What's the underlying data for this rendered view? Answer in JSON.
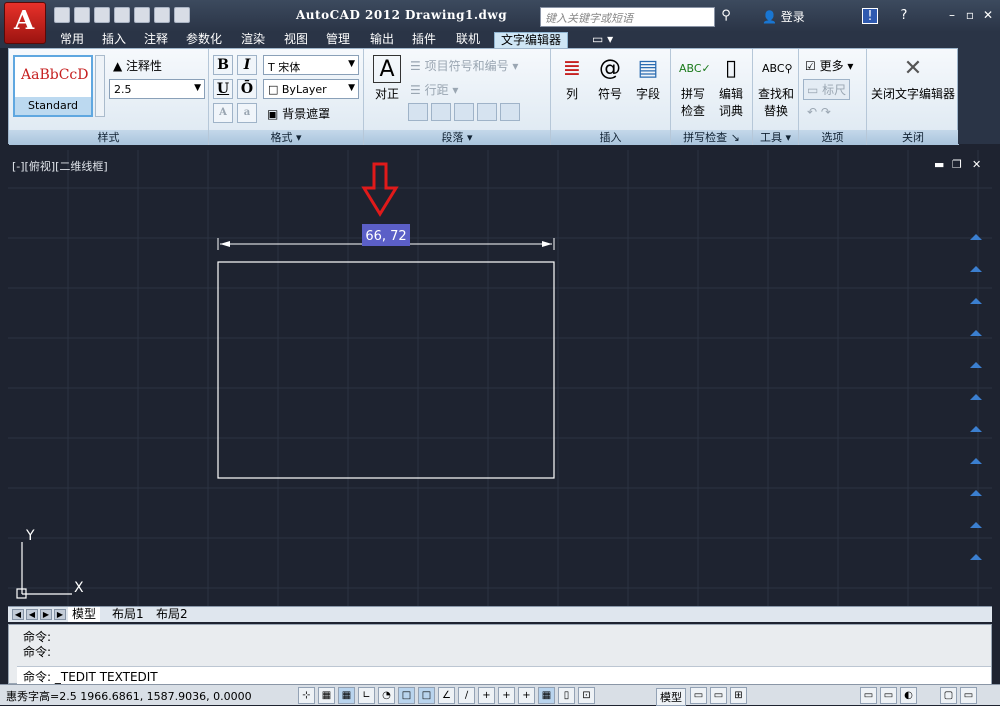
{
  "titlebar": {
    "app_title": "AutoCAD 2012",
    "doc_title": "Drawing1.dwg",
    "search_placeholder": "键入关键字或短语",
    "login_label": "登录"
  },
  "tabs": [
    {
      "label": "常用"
    },
    {
      "label": "插入"
    },
    {
      "label": "注释"
    },
    {
      "label": "参数化"
    },
    {
      "label": "渲染"
    },
    {
      "label": "视图"
    },
    {
      "label": "管理"
    },
    {
      "label": "输出"
    },
    {
      "label": "插件"
    },
    {
      "label": "联机"
    },
    {
      "label": "文字编辑器",
      "active": true
    }
  ],
  "ribbon": {
    "style_panel": {
      "label": "样式",
      "preview_sample": "AaBbCcD",
      "preview_name": "Standard",
      "annotative_label": "注释性",
      "height_value": "2.5"
    },
    "format_panel": {
      "label": "格式",
      "bold": "B",
      "italic": "I",
      "underline": "U",
      "overline": "Ō",
      "font_value": "宋体",
      "color_value": "ByLayer",
      "mask_label": "背景遮罩"
    },
    "paragraph_panel": {
      "label": "段落",
      "justify_label": "对正",
      "bullets_label": "项目符号和编号",
      "spacing_label": "行距"
    },
    "insert_panel": {
      "label": "插入",
      "columns_label": "列",
      "symbol_label": "符号",
      "field_label": "字段"
    },
    "spell_panel": {
      "label": "拼写检查",
      "spellcheck_label_1": "拼写",
      "spellcheck_label_2": "检查",
      "dictionary_label_1": "编辑",
      "dictionary_label_2": "词典"
    },
    "tools_panel": {
      "label": "工具",
      "find_label_1": "查找和",
      "find_label_2": "替换"
    },
    "options_panel": {
      "label": "选项",
      "more_label": "更多",
      "ruler_label": "标尺"
    },
    "close_panel": {
      "label": "关闭",
      "close_label": "关闭文字编辑器"
    }
  },
  "viewport": {
    "label": "[-][俯视][二维线框]",
    "dimension_value": "66, 72",
    "y_axis": "Y",
    "x_axis": "X"
  },
  "layout_tabs": [
    {
      "label": "模型",
      "active": true
    },
    {
      "label": "布局1"
    },
    {
      "label": "布局2"
    }
  ],
  "command": {
    "history_1": "命令:",
    "history_2": "命令:",
    "current": "命令: _TEDIT TEXTEDIT"
  },
  "status": {
    "coords": "惠秀字高=2.5   1966.6861, 1587.9036, 0.0000",
    "model_label": "模型"
  },
  "colors": {
    "background": "#1e2330",
    "dim_highlight": "#5b5fc7",
    "arrow": "#e01a1a"
  }
}
